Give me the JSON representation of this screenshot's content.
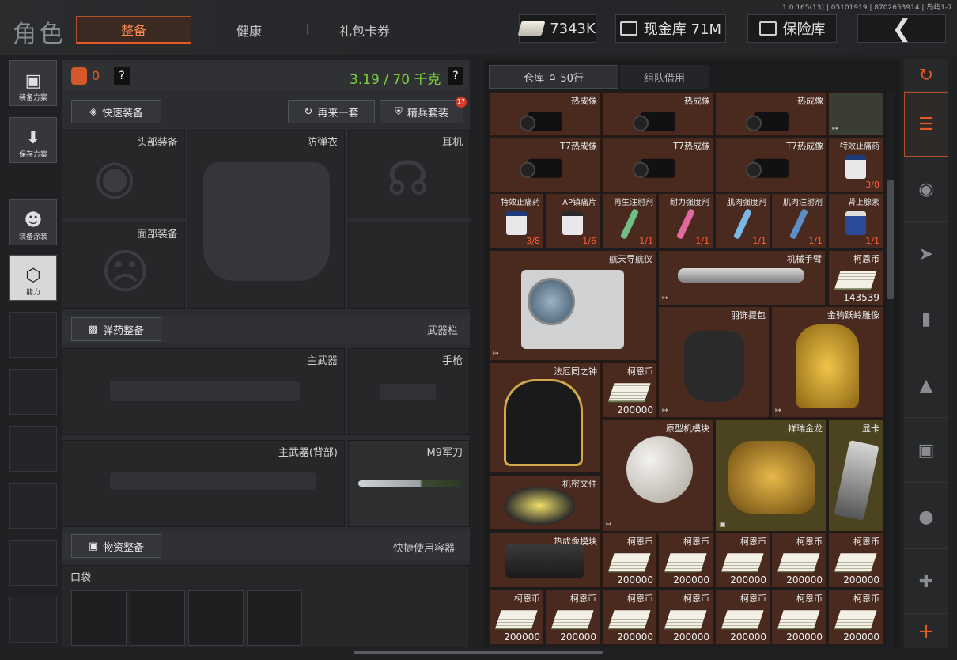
{
  "header": {
    "title": "角色",
    "tabs": [
      {
        "label": "整备"
      },
      {
        "label": "健康"
      },
      {
        "label": "礼包卡券"
      }
    ],
    "version": "1.0.165(13) | 05101919 | 8702653914 | 岛屿1-7",
    "currency": "7343K",
    "cash_vault": "现金库 71M",
    "safe": "保险库",
    "back_icon": "chevron-left-icon"
  },
  "left_nav": {
    "items": [
      {
        "label": "装备方案",
        "icon": "vest-icon"
      },
      {
        "label": "保存方案",
        "icon": "download-icon"
      },
      {
        "label": "装备涂装",
        "icon": "helmet-paint-icon"
      },
      {
        "label": "能力",
        "icon": "ability-icon"
      }
    ]
  },
  "equipment": {
    "armor_count": "0",
    "help": "?",
    "weight": "3.19 / 70 千克",
    "weight_color": "#7fd13b",
    "quick_equip": "快速装备",
    "again": "再来一套",
    "elite_set": "精兵套装",
    "elite_badge": "17",
    "slots": {
      "head": "头部装备",
      "body_armor": "防弹衣",
      "ear": "耳机",
      "face": "面部装备"
    },
    "ammo_section": "弹药整备",
    "weapon_bar": "武器栏",
    "weapons": {
      "primary": "主武器",
      "pistol": "手枪",
      "primary_back": "主武器(背部)",
      "knife": "M9军刀"
    },
    "supply_section": "物资整备",
    "quick_container": "快捷使用容器",
    "pocket": "口袋"
  },
  "warehouse": {
    "tab_storage": "仓库",
    "tab_rows": "50行",
    "tab_team": "组队借用",
    "row1": [
      {
        "name": "热成像"
      },
      {
        "name": "热成像"
      },
      {
        "name": "热成像"
      }
    ],
    "row2": [
      {
        "name": "T7热成像"
      },
      {
        "name": "T7热成像"
      },
      {
        "name": "T7热成像"
      },
      {
        "name": "特效止痛药",
        "count": "3/8"
      }
    ],
    "row3": [
      {
        "name": "特效止痛药",
        "count": "3/8"
      },
      {
        "name": "AP镇痛片",
        "count": "1/6"
      },
      {
        "name": "再生注射剂",
        "count": "1/1"
      },
      {
        "name": "耐力强度剂",
        "count": "1/1"
      },
      {
        "name": "肌肉强度剂",
        "count": "1/1"
      },
      {
        "name": "肌肉注射剂",
        "count": "1/1"
      },
      {
        "name": "肾上腺素",
        "count": "1/1"
      }
    ],
    "big_items": {
      "nav": "航天导航仪",
      "arm": "机械手臂",
      "coin1": {
        "name": "柯恩币",
        "value": "143539"
      },
      "bag": "羽饰提包",
      "horse": "金驹跃岭雕像",
      "clock": "法厄同之钟",
      "coin2": {
        "name": "柯恩币",
        "value": "200000"
      },
      "core": "原型机模块",
      "dragon": "祥瑞金龙",
      "gpu": "显卡",
      "doc": "机密文件",
      "thermal": "热成像模块"
    },
    "coin_row1": [
      {
        "name": "柯恩币",
        "value": "200000"
      },
      {
        "name": "柯恩币",
        "value": "200000"
      },
      {
        "name": "柯恩币",
        "value": "200000"
      },
      {
        "name": "柯恩币",
        "value": "200000"
      },
      {
        "name": "柯恩币",
        "value": "200000"
      }
    ],
    "coin_row2": [
      {
        "name": "柯恩币",
        "value": "200000"
      },
      {
        "name": "柯恩币",
        "value": "200000"
      },
      {
        "name": "柯恩币",
        "value": "200000"
      },
      {
        "name": "柯恩币",
        "value": "200000"
      },
      {
        "name": "柯恩币",
        "value": "200000"
      },
      {
        "name": "柯恩币",
        "value": "200000"
      },
      {
        "name": "柯恩币",
        "value": "200000"
      }
    ]
  },
  "right_nav": {
    "icons": [
      "stack-refresh-icon",
      "stack-icon",
      "helmet-icon",
      "rifle-icon",
      "magazine-icon",
      "bullet-icon",
      "vest-icon",
      "grenade-icon",
      "medkit-icon",
      "plus-icon"
    ]
  },
  "colors": {
    "accent": "#e45a22",
    "item_bg": "#4a2a1f",
    "gold_bg": "#4c4320"
  }
}
